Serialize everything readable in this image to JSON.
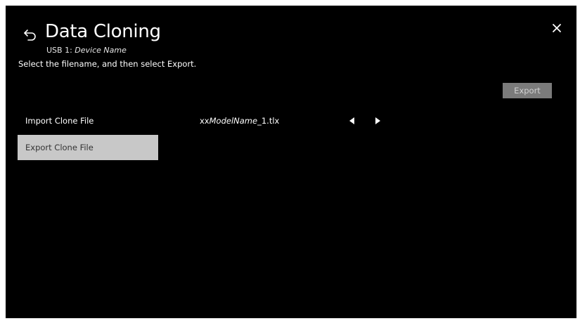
{
  "header": {
    "back_icon": "back-arrow-icon",
    "title": "Data Cloning",
    "device_prefix": "USB 1: ",
    "device_name": "Device Name",
    "instruction": "Select the filename, and then select Export.",
    "close_icon": "close-icon"
  },
  "actions": {
    "export_label": "Export"
  },
  "menu": {
    "items": [
      {
        "label": "Import Clone File"
      },
      {
        "label": "Export Clone File"
      }
    ]
  },
  "file_selector": {
    "prefix": "xx",
    "model": "ModelName",
    "suffix": "_1.tlx",
    "prev_icon": "triangle-left-icon",
    "next_icon": "triangle-right-icon"
  },
  "colors": {
    "background": "#000000",
    "selected_item": "#c8c8c8",
    "export_button": "#7b7b7b"
  }
}
